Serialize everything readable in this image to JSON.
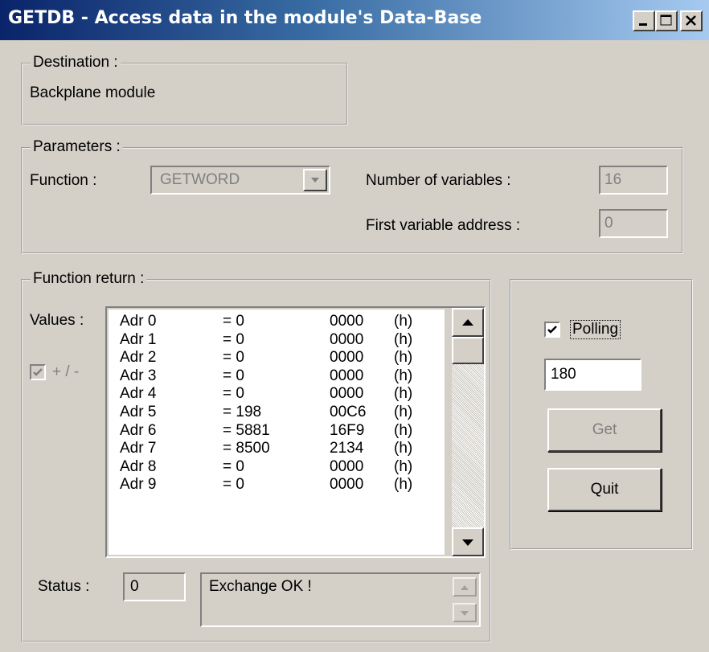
{
  "window": {
    "title": "GETDB - Access data in the module's Data-Base"
  },
  "destination": {
    "legend": "Destination :",
    "value": "Backplane module"
  },
  "parameters": {
    "legend": "Parameters :",
    "function_label": "Function :",
    "function_value": "GETWORD",
    "num_vars_label": "Number of variables :",
    "num_vars_value": "16",
    "first_addr_label": "First variable address :",
    "first_addr_value": "0"
  },
  "function_return": {
    "legend": "Function return :",
    "values_label": "Values :",
    "plusminus_label": "+ / -",
    "plusminus_checked": true,
    "rows": [
      {
        "adr": "Adr 0",
        "val": "= 0",
        "hex": "0000",
        "unit": "(h)"
      },
      {
        "adr": "Adr 1",
        "val": "= 0",
        "hex": "0000",
        "unit": "(h)"
      },
      {
        "adr": "Adr 2",
        "val": "= 0",
        "hex": "0000",
        "unit": "(h)"
      },
      {
        "adr": "Adr 3",
        "val": "= 0",
        "hex": "0000",
        "unit": "(h)"
      },
      {
        "adr": "Adr 4",
        "val": "= 0",
        "hex": "0000",
        "unit": "(h)"
      },
      {
        "adr": "Adr 5",
        "val": "= 198",
        "hex": "00C6",
        "unit": "(h)"
      },
      {
        "adr": "Adr 6",
        "val": "= 5881",
        "hex": "16F9",
        "unit": "(h)"
      },
      {
        "adr": "Adr 7",
        "val": "= 8500",
        "hex": "2134",
        "unit": "(h)"
      },
      {
        "adr": "Adr 8",
        "val": "= 0",
        "hex": "0000",
        "unit": "(h)"
      },
      {
        "adr": "Adr 9",
        "val": "= 0",
        "hex": "0000",
        "unit": "(h)"
      }
    ],
    "status_label": "Status :",
    "status_code": "0",
    "status_message": "Exchange OK !"
  },
  "controls": {
    "polling_label": "Polling",
    "polling_checked": true,
    "polling_value": "180",
    "get_label": "Get",
    "quit_label": "Quit"
  },
  "icons": [
    "minimize-icon",
    "maximize-icon",
    "close-icon",
    "dropdown-arrow-icon",
    "scroll-up-icon",
    "scroll-down-icon",
    "checkmark-icon"
  ]
}
